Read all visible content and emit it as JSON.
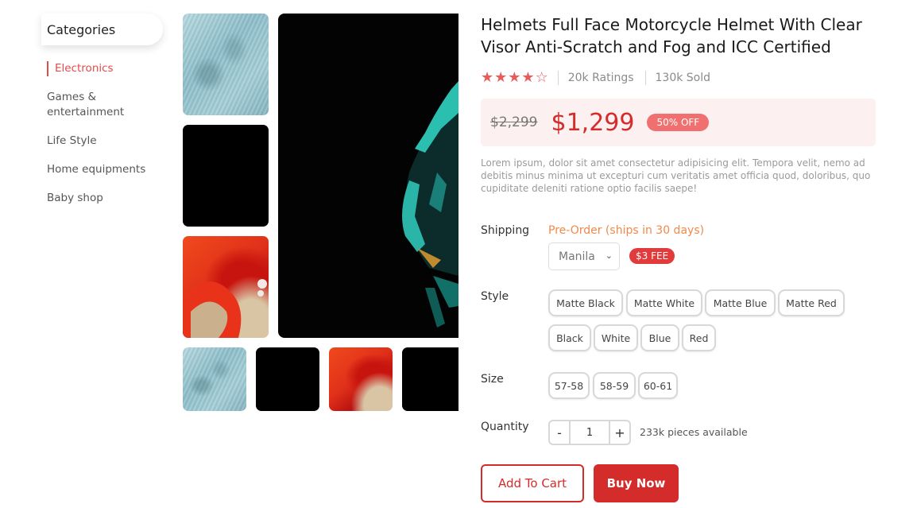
{
  "sidebar": {
    "header": "Categories",
    "items": [
      {
        "label": "Electronics"
      },
      {
        "label": "Games & entertainment"
      },
      {
        "label": "Life Style"
      },
      {
        "label": "Home equipments"
      },
      {
        "label": "Baby shop"
      }
    ]
  },
  "product": {
    "title": "Helmets Full Face Motorcycle Helmet With Clear Visor Anti-Scratch and Fog and ICC Certified",
    "rating": 4,
    "rating_max": 5,
    "ratings_count": "20k Ratings",
    "sold": "130k Sold",
    "old_price": "$2,299",
    "new_price": "$1,299",
    "discount": "50% OFF",
    "description": "Lorem ipsum, dolor sit amet consectetur adipisicing elit. Tempora velit, nemo ad debitis minus minima ut excepturi cum veritatis amet officia quod, doloribus, quo cupiditate deleniti ratione optio facilis saepe!"
  },
  "shipping": {
    "label": "Shipping",
    "status": "Pre-Order (ships in 30 days)",
    "location": "Manila",
    "fee": "$3 FEE"
  },
  "style": {
    "label": "Style",
    "options": [
      "Matte Black",
      "Matte White",
      "Matte Blue",
      "Matte Red",
      "Black",
      "White",
      "Blue",
      "Red"
    ]
  },
  "size": {
    "label": "Size",
    "options": [
      "57-58",
      "58-59",
      "60-61"
    ]
  },
  "quantity": {
    "label": "Quantity",
    "minus": "-",
    "value": "1",
    "plus": "+",
    "available": "233k pieces available"
  },
  "actions": {
    "add_to_cart": "Add To Cart",
    "buy_now": "Buy Now"
  },
  "colors": {
    "accent": "#d42b2b",
    "star": "#e95b5b",
    "preorder": "#f0894a"
  }
}
